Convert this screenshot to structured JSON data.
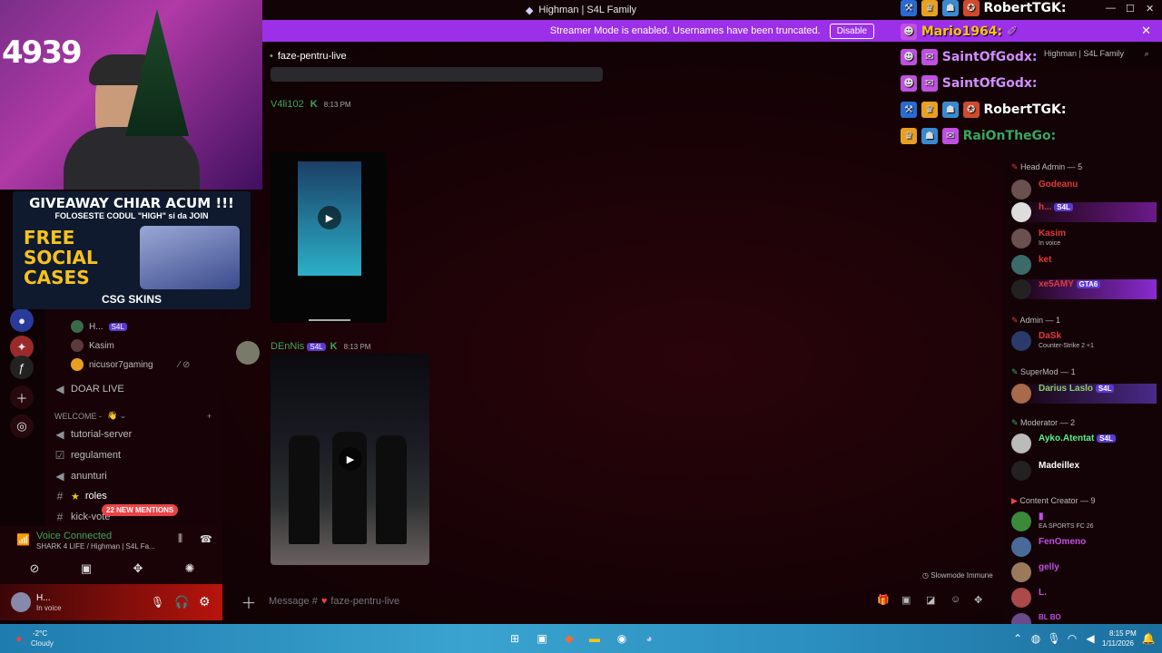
{
  "window": {
    "title": "Highman | S4L Family"
  },
  "banner": {
    "text": "Streamer Mode is enabled. Usernames have been truncated.",
    "button": "Disable"
  },
  "chat": {
    "channel": "faze-pentru-live",
    "messages": [
      {
        "author": "V4li102",
        "time": "8:13 PM",
        "color": "#3ba55d"
      },
      {
        "author": "DEnNis",
        "badge": "S4L",
        "time": "8:13 PM",
        "color": "#3ba55d"
      }
    ],
    "placeholder_prefix": "Message #",
    "placeholder_channel": "faze-pentru-live",
    "slowmode": "Slowmode Immune"
  },
  "channels": {
    "voice_users": [
      {
        "name": "H...",
        "badge": "S4L"
      },
      {
        "name": "Kasim"
      },
      {
        "name": "nicusor7gaming"
      }
    ],
    "items": [
      {
        "label": "DOAR LIVE"
      },
      {
        "label": "WELCOME -"
      },
      {
        "label": "tutorial-server"
      },
      {
        "label": "regulament"
      },
      {
        "label": "anunturi"
      },
      {
        "label": "roles"
      },
      {
        "label": "kick-vote"
      }
    ],
    "mentions": "22 NEW MENTIONS"
  },
  "voice": {
    "status": "Voice Connected",
    "location": "SHARK 4 LIFE / Highman | S4L Fa..."
  },
  "user": {
    "name": "H...",
    "status": "In voice"
  },
  "members": {
    "server_hdr": "Highman | S4L Family",
    "roles": [
      {
        "label": "Head Admin — 5"
      },
      {
        "label": "Admin — 1"
      },
      {
        "label": "SuperMod — 1"
      },
      {
        "label": "Moderator — 2"
      },
      {
        "label": "Content Creator — 9"
      }
    ],
    "list": [
      {
        "name": "Godeanu",
        "color": "#e03a3a"
      },
      {
        "name": "h...",
        "badge": "S4L",
        "color": "#e03a3a"
      },
      {
        "name": "Kasim",
        "status": "In voice",
        "color": "#e03a3a"
      },
      {
        "name": "ket",
        "color": "#e03a3a"
      },
      {
        "name": "xe5AMY",
        "badge": "GTA6",
        "color": "#e03a3a"
      },
      {
        "name": "DaSk",
        "status": "Counter-Strike 2 +1",
        "color": "#e03a3a"
      },
      {
        "name": "Darius Laslo",
        "badge": "S4L",
        "color": "#8bd16a"
      },
      {
        "name": "Ayko.Atentat",
        "badge": "S4L",
        "color": "#57f287"
      },
      {
        "name": "Madeillex",
        "color": "#ffffff"
      },
      {
        "name": "EA SPORTS FC 26",
        "color": "#b9bbbe"
      },
      {
        "name": "FenOmeno",
        "color": "#c050e0"
      },
      {
        "name": "gelly",
        "color": "#c050e0"
      },
      {
        "name": "L.",
        "color": "#c050e0"
      },
      {
        "name": "BL BO",
        "color": "#c050e0"
      }
    ]
  },
  "overlay": {
    "counter": "4939",
    "giveaway": {
      "line1": "GIVEAWAY CHIAR ACUM !!!",
      "line2": "FOLOSESTE CODUL \"HIGH\" si da JOIN",
      "line3a": "FREE",
      "line3b": "SOCIAL",
      "line3c": "CASES",
      "brand": "CSG SKINS"
    },
    "chat": [
      {
        "name": "RobertTGK:",
        "color": "#ffffff"
      },
      {
        "name": "Mario1964:",
        "color": "#f7c21a"
      },
      {
        "name": "SaintOfGodx:",
        "color": "#d58cff"
      },
      {
        "name": "SaintOfGodx:",
        "color": "#d58cff"
      },
      {
        "name": "RobertTGK:",
        "color": "#ffffff"
      },
      {
        "name": "RaiOnTheGo:",
        "color": "#3ba55d"
      }
    ]
  },
  "taskbar": {
    "temp": "-2°C",
    "weather": "Cloudy",
    "time": "8:15 PM",
    "date": "1/11/2026"
  }
}
